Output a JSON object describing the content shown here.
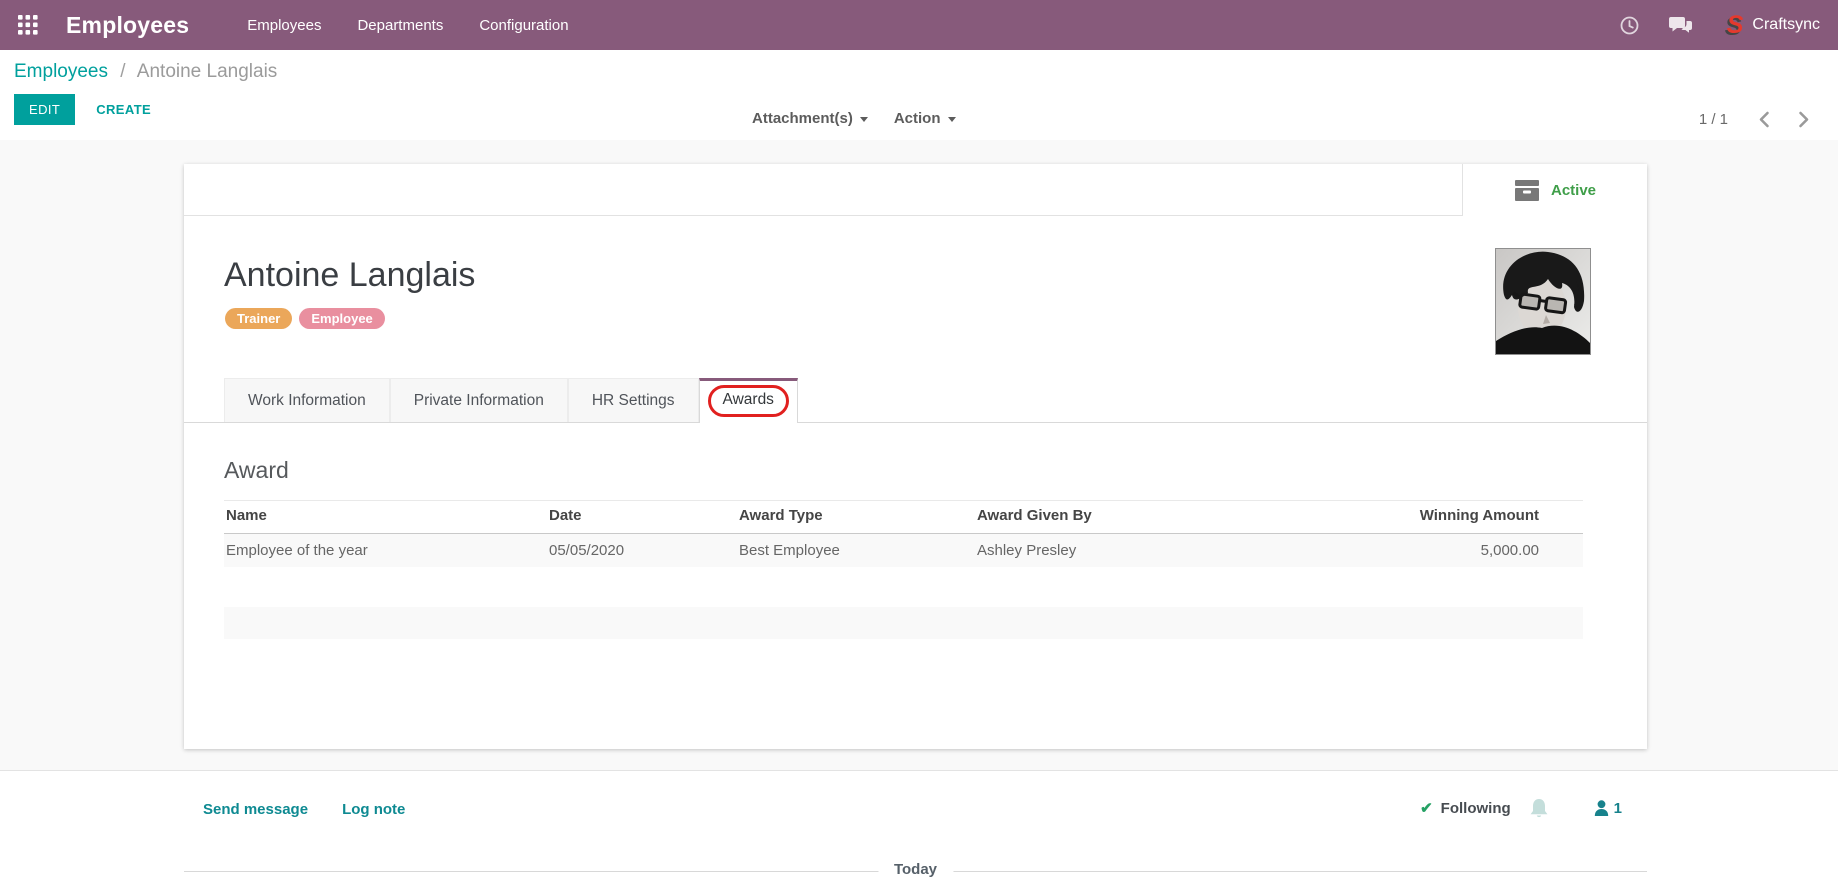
{
  "topbar": {
    "app_title": "Employees",
    "menu_items": [
      "Employees",
      "Departments",
      "Configuration"
    ],
    "company": "Craftsync",
    "logo_letter": "S"
  },
  "control_panel": {
    "breadcrumb": {
      "parent": "Employees",
      "separator": "/",
      "current": "Antoine Langlais"
    },
    "edit_label": "EDIT",
    "create_label": "CREATE",
    "attachments_label": "Attachment(s)",
    "action_label": "Action",
    "pager_value": "1 / 1"
  },
  "form": {
    "stat_button": {
      "label": "Active"
    },
    "employee": {
      "name": "Antoine Langlais",
      "tags": [
        {
          "label": "Trainer",
          "color": "#eba75a"
        },
        {
          "label": "Employee",
          "color": "#e98f9f"
        }
      ]
    },
    "tabs": [
      {
        "label": "Work Information",
        "active": false
      },
      {
        "label": "Private Information",
        "active": false
      },
      {
        "label": "HR Settings",
        "active": false
      },
      {
        "label": "Awards",
        "active": true,
        "annotated": true
      }
    ],
    "awards": {
      "section_title": "Award",
      "table": {
        "columns": [
          "Name",
          "Date",
          "Award Type",
          "Award Given By",
          "Winning Amount"
        ],
        "rows": [
          [
            "Employee of the year",
            "05/05/2020",
            "Best Employee",
            "Ashley Presley",
            "5,000.00"
          ]
        ]
      }
    }
  },
  "chatter": {
    "send_message_label": "Send message",
    "log_note_label": "Log note",
    "following_label": "Following",
    "follower_count": "1",
    "date_divider": "Today"
  },
  "icons": {
    "check": "✔"
  },
  "colors": {
    "brand_purple": "#875a7b",
    "accent_teal": "#00a09d",
    "active_green": "#3f9e49",
    "annotation_red": "#e1201f",
    "tag_orange": "#eba75a",
    "tag_pink": "#e98f9f"
  }
}
